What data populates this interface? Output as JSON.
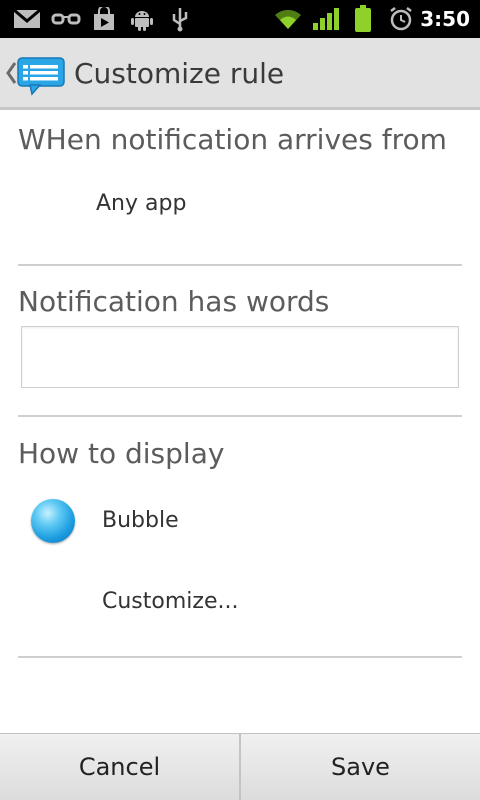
{
  "status_bar": {
    "time": "3:50",
    "icons": [
      "gmail-icon",
      "glasses-icon",
      "play-store-icon",
      "android-icon",
      "usb-icon",
      "wifi-icon",
      "signal-icon",
      "battery-icon",
      "alarm-icon"
    ]
  },
  "action_bar": {
    "title": "Customize rule"
  },
  "sections": {
    "source": {
      "heading": "WHen notification arrives from",
      "value": "Any app"
    },
    "words": {
      "heading": "Notification has words",
      "input_value": ""
    },
    "display": {
      "heading": "How to display",
      "style_label": "Bubble",
      "customize_label": "Customize..."
    }
  },
  "buttons": {
    "cancel": "Cancel",
    "save": "Save"
  },
  "colors": {
    "status_bar_bg": "#000000",
    "action_bar_bg": "#e2e2e2",
    "accent_blue": "#1e9fe0",
    "signal_green": "#8fd12a"
  }
}
